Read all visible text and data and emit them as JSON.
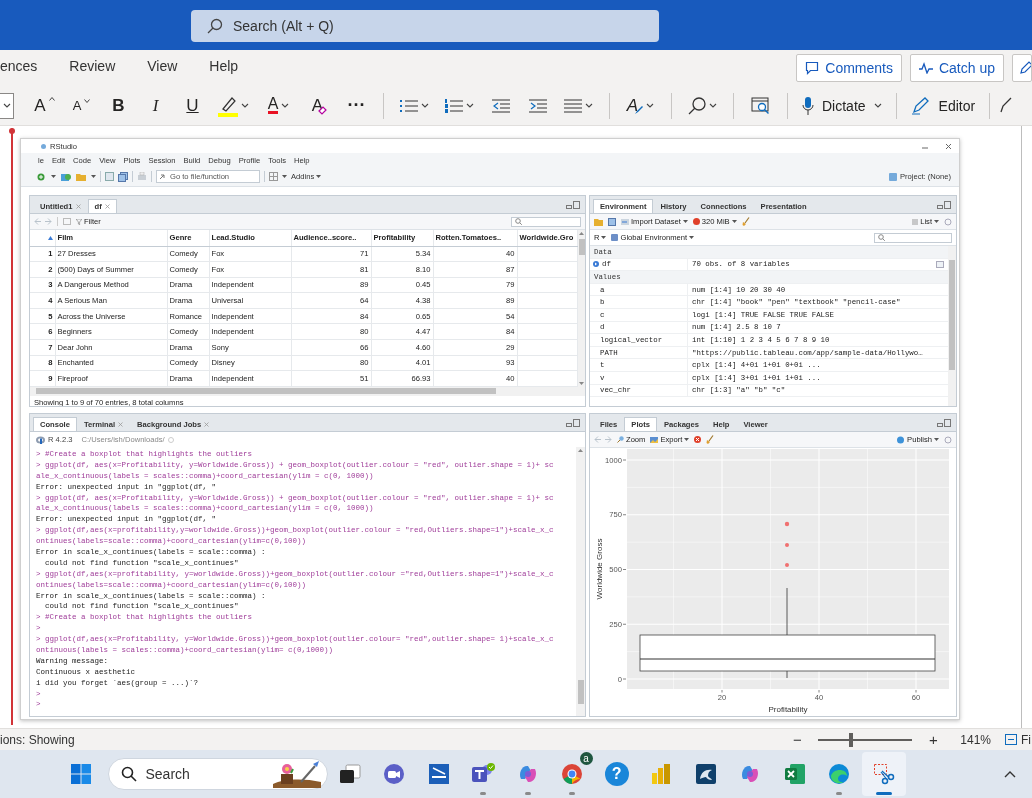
{
  "word": {
    "search": {
      "placeholder": "Search (Alt + Q)"
    },
    "menu_tabs": [
      {
        "label": "ences",
        "selected": false
      },
      {
        "label": "Review",
        "selected": false
      },
      {
        "label": "View",
        "selected": false
      },
      {
        "label": "Help",
        "selected": false
      }
    ],
    "header_buttons": [
      {
        "kind": "comments",
        "label": "Comments"
      },
      {
        "kind": "catch-up",
        "label": "Catch up"
      },
      {
        "kind": "pen"
      }
    ],
    "ribbon": [
      {
        "kind": "font-size"
      },
      {
        "kind": "grow-font",
        "text": "A"
      },
      {
        "kind": "shrink-font",
        "text": "A"
      },
      {
        "kind": "bold",
        "text": "B"
      },
      {
        "kind": "italic",
        "text": "I"
      },
      {
        "kind": "underline",
        "text": "U"
      },
      {
        "kind": "highlight",
        "dropdown": true
      },
      {
        "kind": "font-color",
        "text": "A",
        "dropdown": true
      },
      {
        "kind": "clear-format",
        "text": "A"
      },
      {
        "kind": "more",
        "text": "···"
      },
      {
        "kind": "separator"
      },
      {
        "kind": "bullets",
        "dropdown": true
      },
      {
        "kind": "numbering",
        "dropdown": true
      },
      {
        "kind": "outdent"
      },
      {
        "kind": "indent"
      },
      {
        "kind": "align",
        "dropdown": true
      },
      {
        "kind": "separator"
      },
      {
        "kind": "styles",
        "text": "A",
        "dropdown": true
      },
      {
        "kind": "separator"
      },
      {
        "kind": "find",
        "dropdown": true
      },
      {
        "kind": "separator"
      },
      {
        "kind": "reuse"
      },
      {
        "kind": "separator"
      },
      {
        "kind": "dictate",
        "text": "Dictate",
        "dropdown": true
      },
      {
        "kind": "separator"
      },
      {
        "kind": "editor",
        "text": "Editor"
      },
      {
        "kind": "separator"
      },
      {
        "kind": "pen"
      }
    ]
  },
  "rstudio": {
    "title": "RStudio",
    "menu": [
      "le",
      "Edit",
      "Code",
      "View",
      "Plots",
      "Session",
      "Build",
      "Debug",
      "Profile",
      "Tools",
      "Help"
    ],
    "toolbar": {
      "goto_placeholder": "Go to file/function",
      "addins": "Addins",
      "project": "Project: (None)"
    },
    "source": {
      "tabs": [
        {
          "label": "Untitled1",
          "selected": false,
          "closable": true
        },
        {
          "label": "df",
          "selected": true,
          "closable": true
        }
      ],
      "filter": "Filter",
      "columns": [
        {
          "label": "Film",
          "numeric": false
        },
        {
          "label": "Genre",
          "numeric": false
        },
        {
          "label": "Lead.Studio",
          "numeric": false
        },
        {
          "label": "Audience..score..",
          "numeric": true
        },
        {
          "label": "Profitability",
          "numeric": true
        },
        {
          "label": "Rotten.Tomatoes..",
          "numeric": true
        },
        {
          "label": "Worldwide.Gro"
        }
      ],
      "rows": [
        {
          "num": "1",
          "cells": [
            "27 Dresses",
            "Comedy",
            "Fox",
            "71",
            "5.34",
            "40"
          ]
        },
        {
          "num": "2",
          "cells": [
            "(500) Days of Summer",
            "Comedy",
            "Fox",
            "81",
            "8.10",
            "87"
          ]
        },
        {
          "num": "3",
          "cells": [
            "A Dangerous Method",
            "Drama",
            "Independent",
            "89",
            "0.45",
            "79"
          ]
        },
        {
          "num": "4",
          "cells": [
            "A Serious Man",
            "Drama",
            "Universal",
            "64",
            "4.38",
            "89"
          ]
        },
        {
          "num": "5",
          "cells": [
            "Across the Universe",
            "Romance",
            "Independent",
            "84",
            "0.65",
            "54"
          ]
        },
        {
          "num": "6",
          "cells": [
            "Beginners",
            "Comedy",
            "Independent",
            "80",
            "4.47",
            "84"
          ]
        },
        {
          "num": "7",
          "cells": [
            "Dear John",
            "Drama",
            "Sony",
            "66",
            "4.60",
            "29"
          ]
        },
        {
          "num": "8",
          "cells": [
            "Enchanted",
            "Comedy",
            "Disney",
            "80",
            "4.01",
            "93"
          ]
        },
        {
          "num": "9",
          "cells": [
            "Fireproof",
            "Drama",
            "Independent",
            "51",
            "66.93",
            "40"
          ]
        }
      ],
      "footer": "Showing 1 to 9 of 70 entries, 8 total columns"
    },
    "environment": {
      "tabs": [
        {
          "label": "Environment",
          "selected": true
        },
        {
          "label": "History",
          "selected": false
        },
        {
          "label": "Connections",
          "selected": false
        },
        {
          "label": "Presentation",
          "selected": false
        }
      ],
      "import": "Import Dataset",
      "memory": "320 MiB",
      "view": "List",
      "language": "R",
      "scope": "Global Environment",
      "sections": [
        {
          "title": "Data",
          "items": [
            {
              "kind": "data",
              "name": "df",
              "value": "70 obs. of 8 variables"
            }
          ]
        },
        {
          "title": "Values",
          "items": [
            {
              "kind": "value",
              "name": "a",
              "value": "num [1:4] 10 20 30 40"
            },
            {
              "kind": "value",
              "name": "b",
              "value": "chr [1:4] \"book\" \"pen\" \"textbook\" \"pencil-case\""
            },
            {
              "kind": "value",
              "name": "c",
              "value": "logi [1:4] TRUE FALSE TRUE FALSE"
            },
            {
              "kind": "value",
              "name": "d",
              "value": "num [1:4] 2.5 8 10 7"
            },
            {
              "kind": "value",
              "name": "logical_vector",
              "value": "int [1:10] 1 2 3 4 5 6 7 8 9 10"
            },
            {
              "kind": "value",
              "name": "PATH",
              "value": "\"https://public.tableau.com/app/sample-data/Hollywo…"
            },
            {
              "kind": "value",
              "name": "t",
              "value": "cplx [1:4] 4+0i 1+0i 0+0i ..."
            },
            {
              "kind": "value",
              "name": "v",
              "value": "cplx [1:4] 3+0i 1+0i 1+0i ..."
            },
            {
              "kind": "value",
              "name": "vec_chr",
              "value": "chr [1:3] \"a\" \"b\" \"c\""
            }
          ]
        }
      ]
    },
    "console": {
      "tabs": [
        {
          "label": "Console",
          "selected": true,
          "closable": false
        },
        {
          "label": "Terminal",
          "selected": false,
          "closable": true
        },
        {
          "label": "Background Jobs",
          "selected": false,
          "closable": true
        }
      ],
      "version": "R 4.2.3",
      "path": "C:/Users/ish/Downloads/",
      "lines": [
        {
          "kind": "input",
          "text": "> #Create a boxplot that highlights the outliers"
        },
        {
          "kind": "input",
          "text": "> ggplot(df, aes(x=Profitability, y=Worldwide.Gross)) + geom_boxplot(outlier.colour = \"red\", outlier.shape = 1)+ sc"
        },
        {
          "kind": "input",
          "text": "ale_x_continuous(labels = scales::comma)+coord_cartesian(ylim = c(0, 1000))"
        },
        {
          "kind": "output",
          "text": "Error: unexpected input in \"ggplot(df, \""
        },
        {
          "kind": "input",
          "text": "> ggplot(df, aes(x=Profitability, y=Worldwide.Gross)) + geom_boxplot(outlier.colour = \"red\", outlier.shape = 1)+ sc"
        },
        {
          "kind": "input",
          "text": "ale_x_continuous(labels = scales::comma)+coord_cartesian(ylim = c(0, 1000))"
        },
        {
          "kind": "output",
          "text": "Error: unexpected input in \"ggplot(df, \""
        },
        {
          "kind": "input",
          "text": "> ggplot(df,aes(x=profitability,y=worldwide.Gross))+geom_boxplot(outlier.colour = \"red,Outliers.shape=1\")+scale_x_c"
        },
        {
          "kind": "input",
          "text": "ontinues(labels=scale::comma)+coord_cartesian(ylim=c(0,100))"
        },
        {
          "kind": "output",
          "text": "Error in scale_x_continues(labels = scale::comma) :"
        },
        {
          "kind": "output",
          "text": "  could not find function \"scale_x_continues\""
        },
        {
          "kind": "input",
          "text": "> ggplot(df,aes(x=profitability, y=worldwide.Gross))+geom_boxplot(outlier.colour =\"red,Outliers.shape=1\")+scale_x_c"
        },
        {
          "kind": "input",
          "text": "ontinues(labels=scale::comma)+coord_cartesian(ylim=c(0,100))"
        },
        {
          "kind": "output",
          "text": "Error in scale_x_continues(labels = scale::comma) :"
        },
        {
          "kind": "output",
          "text": "  could not find function \"scale_x_continues\""
        },
        {
          "kind": "input",
          "text": "> #Create a boxplot that highlights the outliers"
        },
        {
          "kind": "input",
          "text": ">"
        },
        {
          "kind": "input",
          "text": "> ggplot(df,aes(x=Profitability, y=Worldwide.Gross))+geom_boxplot(outlier.colour= \"red\",outlier.shape= 1)+scale_x_c"
        },
        {
          "kind": "input",
          "text": "ontinuous(labels = scales::comma)+coord_cartesian(ylim= c(0,1000))"
        },
        {
          "kind": "output",
          "text": "Warning message:"
        },
        {
          "kind": "output",
          "text": "Continuous x aesthetic"
        },
        {
          "kind": "info",
          "text": "i did you forget `aes(group = ...)`?"
        },
        {
          "kind": "input",
          "text": ">"
        },
        {
          "kind": "input",
          "text": ">"
        }
      ]
    },
    "plots": {
      "tabs": [
        {
          "label": "Files",
          "selected": false
        },
        {
          "label": "Plots",
          "selected": true
        },
        {
          "label": "Packages",
          "selected": false
        },
        {
          "label": "Help",
          "selected": false
        },
        {
          "label": "Viewer",
          "selected": false
        }
      ],
      "zoom": "Zoom",
      "export": "Export",
      "publish": "Publish",
      "plot": {
        "y_ticks": [
          "1000",
          "750",
          "500",
          "250",
          "0"
        ],
        "x_ticks": [
          "20",
          "40",
          "60"
        ],
        "xlabel": "Profitability",
        "ylabel": "Worldwide Gross"
      }
    }
  },
  "status_bar": {
    "text": "ions: Showing",
    "zoom_out": "−",
    "zoom_in": "+",
    "level": 0.35,
    "zoom": "141%",
    "fit": "Fi"
  },
  "taskbar": {
    "search": "Search",
    "apps": [
      {
        "kind": "task-view",
        "running": false,
        "selected": false
      },
      {
        "kind": "video-chat",
        "running": false,
        "selected": false
      },
      {
        "kind": "scanner",
        "running": false,
        "selected": false
      },
      {
        "kind": "people",
        "running": true,
        "selected": false
      },
      {
        "kind": "swirl",
        "running": true,
        "selected": false
      },
      {
        "kind": "browser",
        "badge": "a",
        "running": true,
        "selected": false
      },
      {
        "kind": "help",
        "text": "?",
        "running": false,
        "selected": false
      },
      {
        "kind": "bar-chart",
        "running": false,
        "selected": false
      },
      {
        "kind": "dolphin",
        "running": false,
        "selected": false
      },
      {
        "kind": "swirl",
        "running": false,
        "selected": false
      },
      {
        "kind": "spreadsheet",
        "running": false,
        "selected": false
      },
      {
        "kind": "wave-browser",
        "running": true,
        "selected": false
      },
      {
        "kind": "scissors",
        "running": true,
        "selected": true
      }
    ]
  }
}
